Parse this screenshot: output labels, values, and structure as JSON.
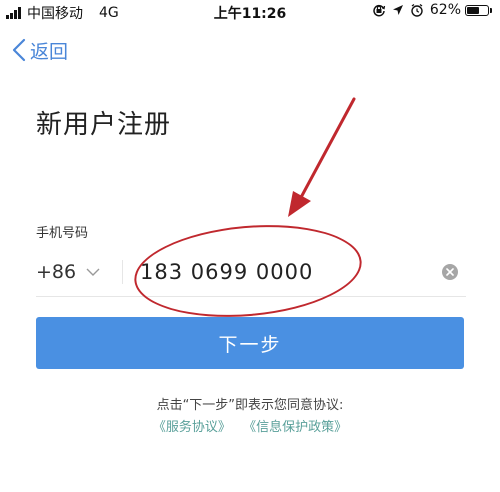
{
  "status_bar": {
    "carrier": "中国移动",
    "network": "4G",
    "time": "上午11:26",
    "battery_percent": "62%",
    "battery_level": 0.62,
    "icons": [
      "signal-icon",
      "orientation-lock-icon",
      "location-icon",
      "alarm-icon",
      "battery-icon"
    ]
  },
  "nav": {
    "back_label": "返回",
    "back_icon": "chevron-left-icon"
  },
  "page": {
    "title": "新用户注册"
  },
  "phone_field": {
    "label": "手机号码",
    "country_code": "+86",
    "country_dropdown_icon": "chevron-down-icon",
    "value": "183 0699 0000",
    "clear_icon": "clear-icon"
  },
  "next_button": {
    "label": "下一步"
  },
  "agreement": {
    "text": "点击“下一步”即表示您同意协议:",
    "links": [
      "《服务协议》",
      "《信息保护政策》"
    ]
  },
  "colors": {
    "accent": "#4a90e2",
    "link": "#5aa09a",
    "annotation": "#c0282e"
  }
}
